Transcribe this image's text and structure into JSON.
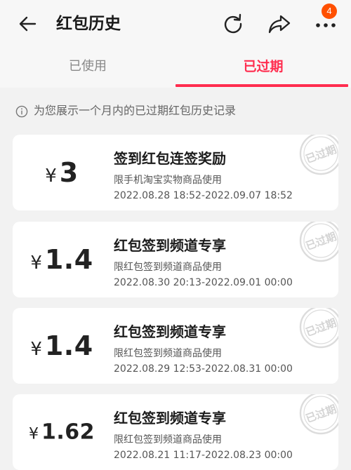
{
  "header": {
    "title": "红包历史",
    "badge_count": "4"
  },
  "tabs": [
    {
      "label": "已使用",
      "active": false
    },
    {
      "label": "已过期",
      "active": true
    }
  ],
  "notice": {
    "text": "为您展示一个月内的已过期红包历史记录"
  },
  "cards": [
    {
      "currency": "¥",
      "amount": "3",
      "title": "签到红包连签奖励",
      "usage": "限手机淘宝实物商品使用",
      "period": "2022.08.28 18:52-2022.09.07 18:52",
      "stamp": "已过期"
    },
    {
      "currency": "¥",
      "amount": "1.4",
      "title": "红包签到频道专享",
      "usage": "限红包签到频道商品使用",
      "period": "2022.08.30 20:13-2022.09.01 00:00",
      "stamp": "已过期"
    },
    {
      "currency": "¥",
      "amount": "1.4",
      "title": "红包签到频道专享",
      "usage": "限红包签到频道商品使用",
      "period": "2022.08.29 12:53-2022.08.31 00:00",
      "stamp": "已过期"
    },
    {
      "currency": "¥",
      "amount": "1.62",
      "title": "红包签到频道专享",
      "usage": "限红包签到频道商品使用",
      "period": "2022.08.21 11:17-2022.08.23 00:00",
      "stamp": "已过期"
    }
  ],
  "colors": {
    "accent": "#ff2d4f",
    "badge": "#ff5000",
    "stamp": "#d9d9d9"
  }
}
